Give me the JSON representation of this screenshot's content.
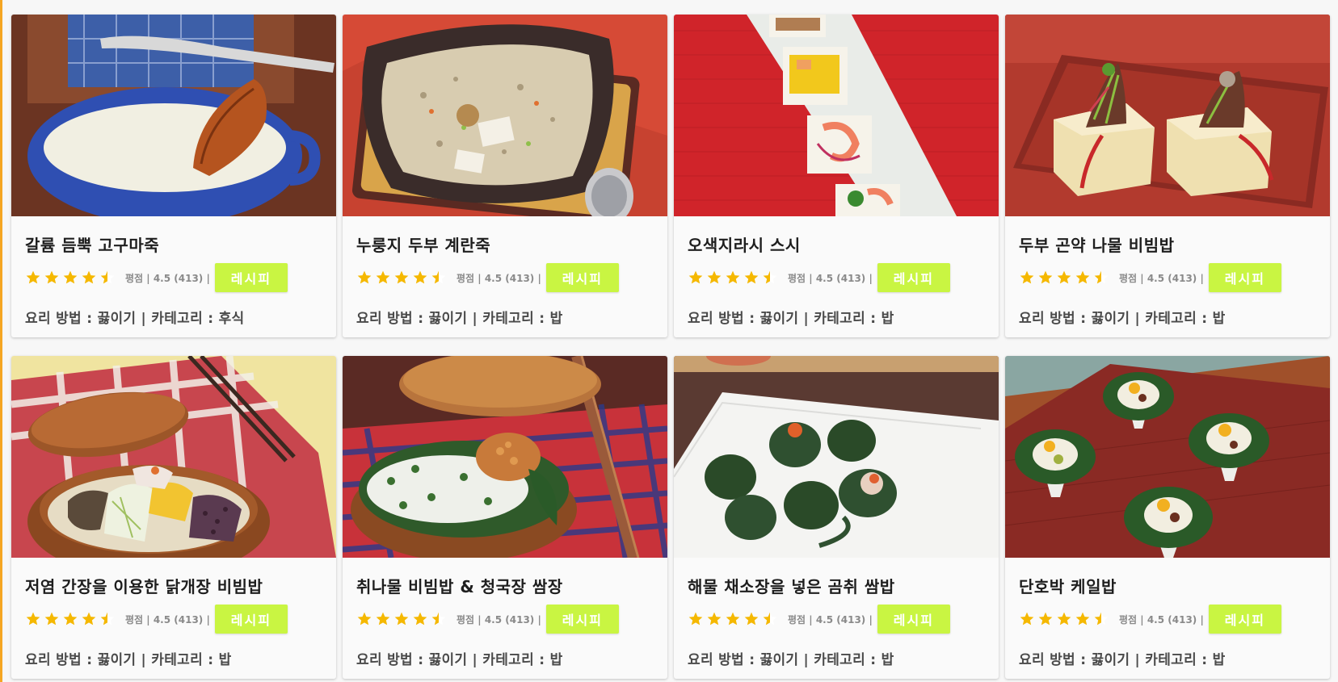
{
  "colors": {
    "star": "#f5b800",
    "button": "#c9f542",
    "button_text": "#ffffff",
    "accent_edge": "#f5a623"
  },
  "recipes": [
    {
      "title": "갈륨 듬뿍 고구마죽",
      "rating": 4.5,
      "rating_meta": "평점 | 4.5 (413) |",
      "button_label": "레시피",
      "meta": "요리 방법 : 끓이기 | 카테고리 : 후식",
      "photo": "blue bowl of sweet potato porridge"
    },
    {
      "title": "누룽지 두부 계란죽",
      "rating": 4.5,
      "rating_meta": "평점 | 4.5 (413) |",
      "button_label": "레시피",
      "meta": "요리 방법 : 끓이기 | 카테고리 : 밥",
      "photo": "dark bowl of rice porridge with tofu"
    },
    {
      "title": "오색지라시 스시",
      "rating": 4.5,
      "rating_meta": "평점 | 4.5 (413) |",
      "button_label": "레시피",
      "meta": "요리 방법 : 끓이기 | 카테고리 : 밥",
      "photo": "sushi pieces on long white plate on red mat"
    },
    {
      "title": "두부 곤약 나물 비빔밥",
      "rating": 4.5,
      "rating_meta": "평점 | 4.5 (413) |",
      "button_label": "레시피",
      "meta": "요리 방법 : 끓이기 | 카테고리 : 밥",
      "photo": "tofu blocks topped with vegetables"
    },
    {
      "title": "저염 간장을 이용한 닭개장 비빔밥",
      "rating": 4.5,
      "rating_meta": "평점 | 4.5 (413) |",
      "button_label": "레시피",
      "meta": "요리 방법 : 끓이기 | 카테고리 : 밥",
      "photo": "wooden lunch box with bibimbap"
    },
    {
      "title": "취나물 비빔밥 & 청국장 쌈장",
      "rating": 4.5,
      "rating_meta": "평점 | 4.5 (413) |",
      "button_label": "레시피",
      "meta": "요리 방법 : 끓이기 | 카테고리 : 밥",
      "photo": "wooden box with greens rice on checked cloth"
    },
    {
      "title": "해물 채소장을 넣은 곰취 쌈밥",
      "rating": 4.5,
      "rating_meta": "평점 | 4.5 (413) |",
      "button_label": "레시피",
      "meta": "요리 방법 : 끓이기 | 카테고리 : 밥",
      "photo": "leaf wrapped rice balls on white plate"
    },
    {
      "title": "단호박 케일밥",
      "rating": 4.5,
      "rating_meta": "평점 | 4.5 (413) |",
      "button_label": "레시피",
      "meta": "요리 방법 : 끓이기 | 카테고리 : 밥",
      "photo": "kale cups with pumpkin rice on red board"
    }
  ]
}
